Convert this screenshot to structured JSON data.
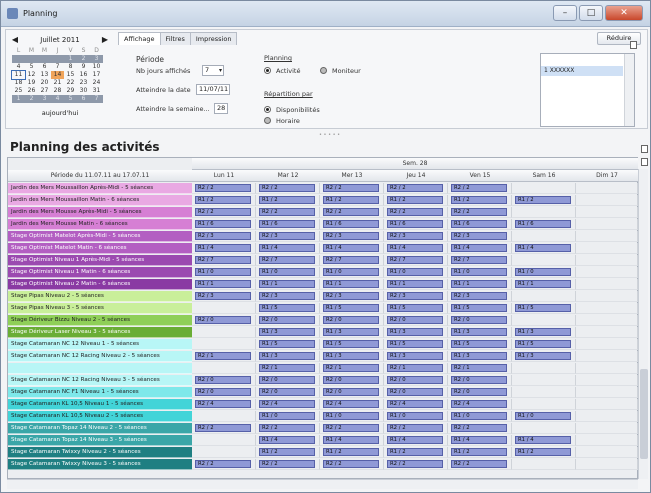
{
  "window": {
    "title": "Planning",
    "min": "–",
    "max": "□",
    "close": "✕"
  },
  "calendar": {
    "month": "Juillet 2011",
    "prev": "◀",
    "next": "▶",
    "dow": [
      "L",
      "M",
      "M",
      "J",
      "V",
      "S",
      "D"
    ],
    "weeks": [
      [
        "",
        "",
        "",
        "",
        "1",
        "2",
        "3"
      ],
      [
        "4",
        "5",
        "6",
        "7",
        "8",
        "9",
        "10"
      ],
      [
        "11",
        "12",
        "13",
        "14",
        "15",
        "16",
        "17"
      ],
      [
        "18",
        "19",
        "20",
        "21",
        "22",
        "23",
        "24"
      ],
      [
        "25",
        "26",
        "27",
        "28",
        "29",
        "30",
        "31"
      ],
      [
        "1",
        "2",
        "3",
        "4",
        "5",
        "6",
        "7"
      ]
    ],
    "today_label": "aujourd'hui"
  },
  "tabs": [
    "Affichage",
    "Filtres",
    "Impression"
  ],
  "reduce_label": "Réduire",
  "periode": {
    "title": "Période",
    "nb_jours_label": "Nb jours affichés",
    "nb_jours_value": "7",
    "atteindre_date_label": "Atteindre la date",
    "atteindre_date_value": "11/07/11",
    "atteindre_semaine_label": "Atteindre la semaine...",
    "atteindre_semaine_value": "28"
  },
  "planning": {
    "title": "Planning",
    "opt1": "Activité",
    "opt2": "Moniteur",
    "repartition_title": "Répartition par",
    "opt3": "Disponibilités",
    "opt4": "Horaire"
  },
  "list": {
    "item": "1 XXXXXX"
  },
  "page_title": "Planning des activités",
  "grid": {
    "week_label": "Sem. 28",
    "period_label": "Période du 11.07.11 au 17.07.11",
    "days": [
      "Lun 11",
      "Mar 12",
      "Mer 13",
      "Jeu 14",
      "Ven 15",
      "Sam 16",
      "Dim 17"
    ],
    "rows": [
      {
        "name": "Jardin des Mers Moussaillon Après-Midi - 5 séances",
        "color": "#e9a9e3",
        "cells": [
          "R2 / 2",
          "R2 / 2",
          "R2 / 2",
          "R2 / 2",
          "R2 / 2",
          "",
          ""
        ]
      },
      {
        "name": "Jardin des Mers Moussaillon Matin - 6 séances",
        "color": "#e9a9e3",
        "cells": [
          "R1 / 2",
          "R1 / 2",
          "R1 / 2",
          "R1 / 2",
          "R1 / 2",
          "R1 / 2",
          ""
        ]
      },
      {
        "name": "Jardin des Mers Mousse Après-Midi - 5 séances",
        "color": "#d67fd4",
        "cells": [
          "R2 / 2",
          "R2 / 2",
          "R2 / 2",
          "R2 / 2",
          "R2 / 2",
          "",
          ""
        ]
      },
      {
        "name": "Jardin des Mers Mousse Matin - 6 séances",
        "color": "#d67fd4",
        "cells": [
          "R1 / 6",
          "R1 / 6",
          "R1 / 6",
          "R1 / 6",
          "R1 / 6",
          "R1 / 6",
          ""
        ]
      },
      {
        "name": "Stage Optimist Matelot Après-Midi - 5 séances",
        "color": "#b35fc2",
        "cells": [
          "R2 / 3",
          "R2 / 3",
          "R2 / 3",
          "R2 / 3",
          "R2 / 3",
          "",
          ""
        ]
      },
      {
        "name": "Stage Optimist Matelot Matin - 6 séances",
        "color": "#b35fc2",
        "cells": [
          "R1 / 4",
          "R1 / 4",
          "R1 / 4",
          "R1 / 4",
          "R1 / 4",
          "R1 / 4",
          ""
        ]
      },
      {
        "name": "Stage Optimist Niveau 1 Après-Midi - 5 séances",
        "color": "#9b4ab0",
        "cells": [
          "R2 / 7",
          "R2 / 7",
          "R2 / 7",
          "R2 / 7",
          "R2 / 7",
          "",
          ""
        ]
      },
      {
        "name": "Stage Optimist Niveau 1 Matin - 6 séances",
        "color": "#9b4ab0",
        "cells": [
          "R1 / 0",
          "R1 / 0",
          "R1 / 0",
          "R1 / 0",
          "R1 / 0",
          "R1 / 0",
          ""
        ]
      },
      {
        "name": "Stage Optimist Niveau 2 Matin - 6 séances",
        "color": "#8a3aa3",
        "cells": [
          "R1 / 1",
          "R1 / 1",
          "R1 / 1",
          "R1 / 1",
          "R1 / 1",
          "R1 / 1",
          ""
        ]
      },
      {
        "name": "Stage Pipas Niveau 2 - 5 séances",
        "color": "#c9ef9a",
        "cells": [
          "R2 / 3",
          "R2 / 3",
          "R2 / 3",
          "R2 / 3",
          "R2 / 3",
          "",
          ""
        ]
      },
      {
        "name": "Stage Pipas Niveau 3 - 5 séances",
        "color": "#c9ef9a",
        "cells": [
          "",
          "R1 / 5",
          "R1 / 5",
          "R1 / 5",
          "R1 / 5",
          "R1 / 5",
          ""
        ]
      },
      {
        "name": "Stage Dériveur Bizzu Niveau 2 - 5 séances",
        "color": "#8fcf58",
        "cells": [
          "R2 / 0",
          "R2 / 0",
          "R2 / 0",
          "R2 / 0",
          "R2 / 0",
          "",
          ""
        ]
      },
      {
        "name": "Stage Dériveur Laser Niveau 3 - 5 séances",
        "color": "#6aad35",
        "cells": [
          "",
          "R1 / 3",
          "R1 / 3",
          "R1 / 3",
          "R1 / 3",
          "R1 / 3",
          ""
        ]
      },
      {
        "name": "Stage Catamaran NC 12 Niveau 1 - 5 séances",
        "color": "#b8f6f6",
        "cells": [
          "",
          "R1 / 5",
          "R1 / 5",
          "R1 / 5",
          "R1 / 5",
          "R1 / 5",
          ""
        ]
      },
      {
        "name": "Stage Catamaran NC 12 Racing Niveau 2 - 5 séances",
        "color": "#b8f6f6",
        "cells": [
          "R2 / 1",
          "R1 / 3",
          "R1 / 3",
          "R1 / 3",
          "R1 / 3",
          "R1 / 3",
          ""
        ]
      },
      {
        "name": "",
        "color": "#b8f6f6",
        "cells": [
          "",
          "R2 / 1",
          "R2 / 1",
          "R2 / 1",
          "R2 / 1",
          "",
          ""
        ]
      },
      {
        "name": "Stage Catamaran NC 12 Racing Niveau 3 - 5 séances",
        "color": "#b8f6f6",
        "cells": [
          "R2 / 0",
          "R2 / 0",
          "R2 / 0",
          "R2 / 0",
          "R2 / 0",
          "",
          ""
        ]
      },
      {
        "name": "Stage Catamaran NC F1 Niveau 1 - 5 séances",
        "color": "#7ee8ea",
        "cells": [
          "R2 / 0",
          "R2 / 0",
          "R2 / 0",
          "R2 / 0",
          "R2 / 0",
          "",
          ""
        ]
      },
      {
        "name": "Stage Catamaran KL 10,5 Niveau 1 - 5 séances",
        "color": "#42d4d8",
        "cells": [
          "R2 / 4",
          "R2 / 4",
          "R2 / 4",
          "R2 / 4",
          "R2 / 4",
          "",
          ""
        ]
      },
      {
        "name": "Stage Catamaran KL 10,5 Niveau 2 - 5 séances",
        "color": "#42d4d8",
        "cells": [
          "",
          "R1 / 0",
          "R1 / 0",
          "R1 / 0",
          "R1 / 0",
          "R1 / 0",
          ""
        ]
      },
      {
        "name": "Stage Catamaran Topaz 14 Niveau 2 - 5 séances",
        "color": "#3aa6a8",
        "cells": [
          "R2 / 2",
          "R2 / 2",
          "R2 / 2",
          "R2 / 2",
          "R2 / 2",
          "",
          ""
        ]
      },
      {
        "name": "Stage Catamaran Topaz 14 Niveau 3 - 5 séances",
        "color": "#3aa6a8",
        "cells": [
          "",
          "R1 / 4",
          "R1 / 4",
          "R1 / 4",
          "R1 / 4",
          "R1 / 4",
          ""
        ]
      },
      {
        "name": "Stage Catamaran Twixxy Niveau 2 - 5 séances",
        "color": "#1f7f82",
        "cells": [
          "",
          "R1 / 2",
          "R1 / 2",
          "R1 / 2",
          "R1 / 2",
          "R1 / 2",
          ""
        ]
      },
      {
        "name": "Stage Catamaran Twixxy Niveau 3 - 5 séances",
        "color": "#1f7f82",
        "cells": [
          "R2 / 2",
          "R2 / 2",
          "R2 / 2",
          "R2 / 2",
          "R2 / 2",
          "",
          ""
        ]
      }
    ]
  }
}
